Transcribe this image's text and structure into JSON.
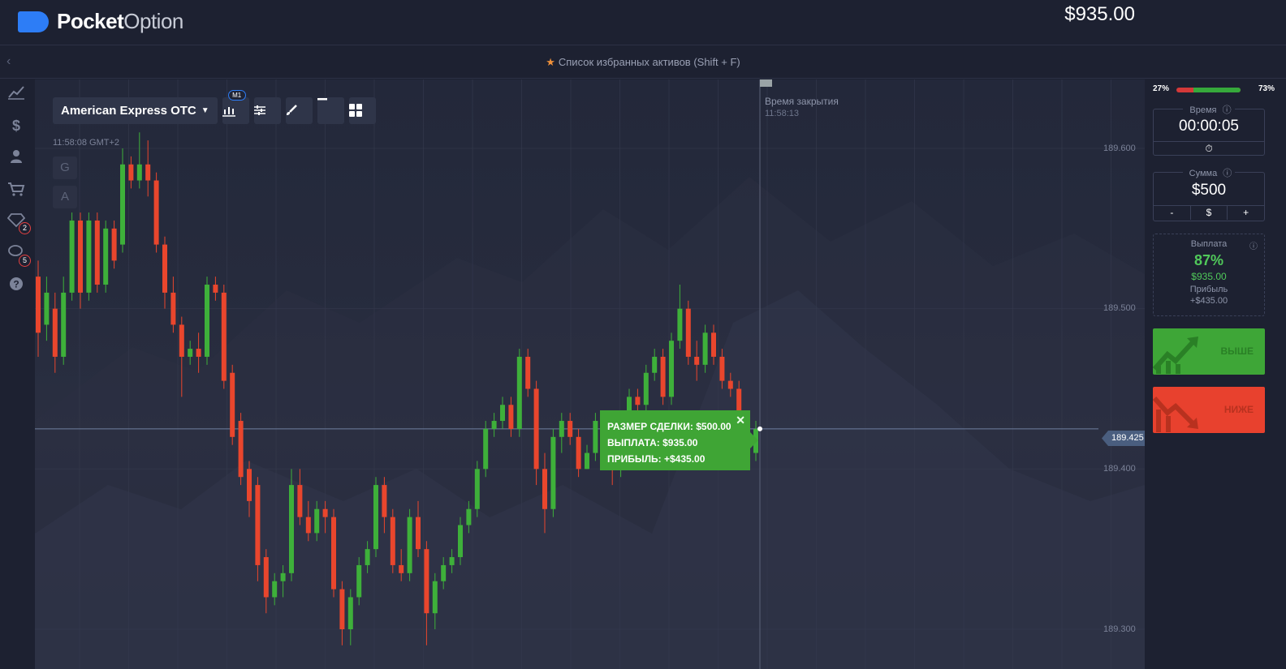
{
  "header": {
    "logo_bold": "Pocket",
    "logo_thin": "Option",
    "balance": "$935.00"
  },
  "favorites": {
    "label": "Список избранных активов (Shift + F)"
  },
  "sidebar": {
    "badges": {
      "achievements": "2",
      "chat": "5"
    },
    "icons": [
      "trading-icon",
      "finance-icon",
      "profile-icon",
      "market-icon",
      "achievements-icon",
      "chat-icon",
      "help-icon"
    ]
  },
  "chart": {
    "asset": "American Express OTC",
    "timeframe": "M1",
    "time": "11:58:08 GMT+2",
    "g_label": "G",
    "a_label": "A",
    "close_label": "Время закрытия",
    "close_time": "11:58:13",
    "current_price": "189.425",
    "axis_labels": [
      "189.600",
      "189.500",
      "189.400",
      "189.300"
    ]
  },
  "trade": {
    "size": "РАЗМЕР СДЕЛКИ: $500.00",
    "payout": "ВЫПЛАТА: $935.00",
    "profit": "ПРИБЫЛЬ: +$435.00"
  },
  "panel": {
    "ratio_left": "27%",
    "ratio_right": "73%",
    "buy_ratio": 0.73,
    "time_title": "Время",
    "time_value": "00:00:05",
    "amount_title": "Сумма",
    "amount_value": "$500",
    "minus": "-",
    "currency": "$",
    "plus": "+",
    "payout_title": "Выплата",
    "payout_percent": "87%",
    "payout_amount": "$935.00",
    "profit_title": "Прибыль",
    "profit_value": "+$435.00",
    "up_label": "ВЫШЕ",
    "down_label": "НИЖЕ"
  },
  "colors": {
    "up": "#3ea637",
    "down": "#e8412e",
    "accent": "#2d7df6"
  },
  "chart_data": {
    "type": "candlestick",
    "ylim": [
      189.28,
      189.62
    ],
    "candles": [
      {
        "o": 189.52,
        "c": 189.485,
        "h": 189.53,
        "l": 189.47
      },
      {
        "o": 189.49,
        "c": 189.51,
        "h": 189.52,
        "l": 189.48
      },
      {
        "o": 189.5,
        "c": 189.47,
        "h": 189.51,
        "l": 189.46
      },
      {
        "o": 189.47,
        "c": 189.51,
        "h": 189.52,
        "l": 189.465
      },
      {
        "o": 189.51,
        "c": 189.555,
        "h": 189.56,
        "l": 189.505
      },
      {
        "o": 189.555,
        "c": 189.51,
        "h": 189.56,
        "l": 189.5
      },
      {
        "o": 189.51,
        "c": 189.555,
        "h": 189.56,
        "l": 189.505
      },
      {
        "o": 189.555,
        "c": 189.515,
        "h": 189.56,
        "l": 189.51
      },
      {
        "o": 189.515,
        "c": 189.55,
        "h": 189.555,
        "l": 189.51
      },
      {
        "o": 189.55,
        "c": 189.53,
        "h": 189.555,
        "l": 189.525
      },
      {
        "o": 189.54,
        "c": 189.59,
        "h": 189.6,
        "l": 189.535
      },
      {
        "o": 189.59,
        "c": 189.58,
        "h": 189.595,
        "l": 189.575
      },
      {
        "o": 189.58,
        "c": 189.59,
        "h": 189.61,
        "l": 189.575
      },
      {
        "o": 189.59,
        "c": 189.58,
        "h": 189.605,
        "l": 189.57
      },
      {
        "o": 189.58,
        "c": 189.54,
        "h": 189.585,
        "l": 189.535
      },
      {
        "o": 189.54,
        "c": 189.51,
        "h": 189.545,
        "l": 189.5
      },
      {
        "o": 189.51,
        "c": 189.49,
        "h": 189.52,
        "l": 189.485
      },
      {
        "o": 189.49,
        "c": 189.47,
        "h": 189.495,
        "l": 189.445
      },
      {
        "o": 189.47,
        "c": 189.475,
        "h": 189.48,
        "l": 189.465
      },
      {
        "o": 189.475,
        "c": 189.47,
        "h": 189.485,
        "l": 189.46
      },
      {
        "o": 189.47,
        "c": 189.515,
        "h": 189.52,
        "l": 189.465
      },
      {
        "o": 189.515,
        "c": 189.51,
        "h": 189.52,
        "l": 189.505
      },
      {
        "o": 189.51,
        "c": 189.455,
        "h": 189.515,
        "l": 189.45
      },
      {
        "o": 189.46,
        "c": 189.42,
        "h": 189.465,
        "l": 189.415
      },
      {
        "o": 189.43,
        "c": 189.395,
        "h": 189.435,
        "l": 189.39
      },
      {
        "o": 189.4,
        "c": 189.38,
        "h": 189.405,
        "l": 189.37
      },
      {
        "o": 189.39,
        "c": 189.34,
        "h": 189.395,
        "l": 189.33
      },
      {
        "o": 189.345,
        "c": 189.32,
        "h": 189.35,
        "l": 189.31
      },
      {
        "o": 189.32,
        "c": 189.33,
        "h": 189.335,
        "l": 189.315
      },
      {
        "o": 189.33,
        "c": 189.335,
        "h": 189.34,
        "l": 189.32
      },
      {
        "o": 189.335,
        "c": 189.39,
        "h": 189.4,
        "l": 189.33
      },
      {
        "o": 189.39,
        "c": 189.37,
        "h": 189.4,
        "l": 189.365
      },
      {
        "o": 189.37,
        "c": 189.36,
        "h": 189.38,
        "l": 189.355
      },
      {
        "o": 189.36,
        "c": 189.375,
        "h": 189.38,
        "l": 189.355
      },
      {
        "o": 189.375,
        "c": 189.37,
        "h": 189.38,
        "l": 189.36
      },
      {
        "o": 189.37,
        "c": 189.325,
        "h": 189.375,
        "l": 189.32
      },
      {
        "o": 189.325,
        "c": 189.3,
        "h": 189.33,
        "l": 189.29
      },
      {
        "o": 189.3,
        "c": 189.32,
        "h": 189.325,
        "l": 189.29
      },
      {
        "o": 189.32,
        "c": 189.34,
        "h": 189.345,
        "l": 189.315
      },
      {
        "o": 189.34,
        "c": 189.35,
        "h": 189.355,
        "l": 189.335
      },
      {
        "o": 189.35,
        "c": 189.39,
        "h": 189.395,
        "l": 189.345
      },
      {
        "o": 189.39,
        "c": 189.37,
        "h": 189.395,
        "l": 189.36
      },
      {
        "o": 189.37,
        "c": 189.34,
        "h": 189.375,
        "l": 189.335
      },
      {
        "o": 189.34,
        "c": 189.335,
        "h": 189.35,
        "l": 189.33
      },
      {
        "o": 189.335,
        "c": 189.37,
        "h": 189.375,
        "l": 189.33
      },
      {
        "o": 189.37,
        "c": 189.35,
        "h": 189.38,
        "l": 189.345
      },
      {
        "o": 189.35,
        "c": 189.31,
        "h": 189.355,
        "l": 189.29
      },
      {
        "o": 189.31,
        "c": 189.33,
        "h": 189.335,
        "l": 189.3
      },
      {
        "o": 189.33,
        "c": 189.34,
        "h": 189.345,
        "l": 189.325
      },
      {
        "o": 189.34,
        "c": 189.345,
        "h": 189.35,
        "l": 189.335
      },
      {
        "o": 189.345,
        "c": 189.365,
        "h": 189.37,
        "l": 189.34
      },
      {
        "o": 189.365,
        "c": 189.375,
        "h": 189.38,
        "l": 189.36
      },
      {
        "o": 189.375,
        "c": 189.4,
        "h": 189.405,
        "l": 189.37
      },
      {
        "o": 189.4,
        "c": 189.425,
        "h": 189.43,
        "l": 189.395
      },
      {
        "o": 189.425,
        "c": 189.43,
        "h": 189.435,
        "l": 189.42
      },
      {
        "o": 189.43,
        "c": 189.44,
        "h": 189.445,
        "l": 189.425
      },
      {
        "o": 189.44,
        "c": 189.425,
        "h": 189.445,
        "l": 189.42
      },
      {
        "o": 189.425,
        "c": 189.47,
        "h": 189.475,
        "l": 189.42
      },
      {
        "o": 189.47,
        "c": 189.45,
        "h": 189.475,
        "l": 189.445
      },
      {
        "o": 189.45,
        "c": 189.4,
        "h": 189.455,
        "l": 189.39
      },
      {
        "o": 189.4,
        "c": 189.375,
        "h": 189.41,
        "l": 189.36
      },
      {
        "o": 189.375,
        "c": 189.42,
        "h": 189.425,
        "l": 189.37
      },
      {
        "o": 189.42,
        "c": 189.43,
        "h": 189.435,
        "l": 189.41
      },
      {
        "o": 189.43,
        "c": 189.42,
        "h": 189.435,
        "l": 189.415
      },
      {
        "o": 189.42,
        "c": 189.4,
        "h": 189.425,
        "l": 189.395
      },
      {
        "o": 189.4,
        "c": 189.41,
        "h": 189.415,
        "l": 189.4
      },
      {
        "o": 189.41,
        "c": 189.43,
        "h": 189.435,
        "l": 189.405
      },
      {
        "o": 189.43,
        "c": 189.415,
        "h": 189.435,
        "l": 189.41
      },
      {
        "o": 189.415,
        "c": 189.4,
        "h": 189.42,
        "l": 189.39
      },
      {
        "o": 189.4,
        "c": 189.415,
        "h": 189.42,
        "l": 189.395
      },
      {
        "o": 189.415,
        "c": 189.445,
        "h": 189.45,
        "l": 189.41
      },
      {
        "o": 189.445,
        "c": 189.44,
        "h": 189.45,
        "l": 189.43
      },
      {
        "o": 189.44,
        "c": 189.46,
        "h": 189.465,
        "l": 189.435
      },
      {
        "o": 189.46,
        "c": 189.47,
        "h": 189.475,
        "l": 189.455
      },
      {
        "o": 189.47,
        "c": 189.445,
        "h": 189.475,
        "l": 189.44
      },
      {
        "o": 189.445,
        "c": 189.48,
        "h": 189.485,
        "l": 189.44
      },
      {
        "o": 189.48,
        "c": 189.5,
        "h": 189.515,
        "l": 189.475
      },
      {
        "o": 189.5,
        "c": 189.47,
        "h": 189.505,
        "l": 189.465
      },
      {
        "o": 189.47,
        "c": 189.465,
        "h": 189.48,
        "l": 189.455
      },
      {
        "o": 189.465,
        "c": 189.485,
        "h": 189.49,
        "l": 189.46
      },
      {
        "o": 189.485,
        "c": 189.47,
        "h": 189.49,
        "l": 189.465
      },
      {
        "o": 189.47,
        "c": 189.455,
        "h": 189.475,
        "l": 189.45
      },
      {
        "o": 189.455,
        "c": 189.45,
        "h": 189.46,
        "l": 189.445
      },
      {
        "o": 189.45,
        "c": 189.43,
        "h": 189.455,
        "l": 189.425
      },
      {
        "o": 189.43,
        "c": 189.41,
        "h": 189.435,
        "l": 189.4
      },
      {
        "o": 189.41,
        "c": 189.425,
        "h": 189.43,
        "l": 189.405
      }
    ]
  }
}
